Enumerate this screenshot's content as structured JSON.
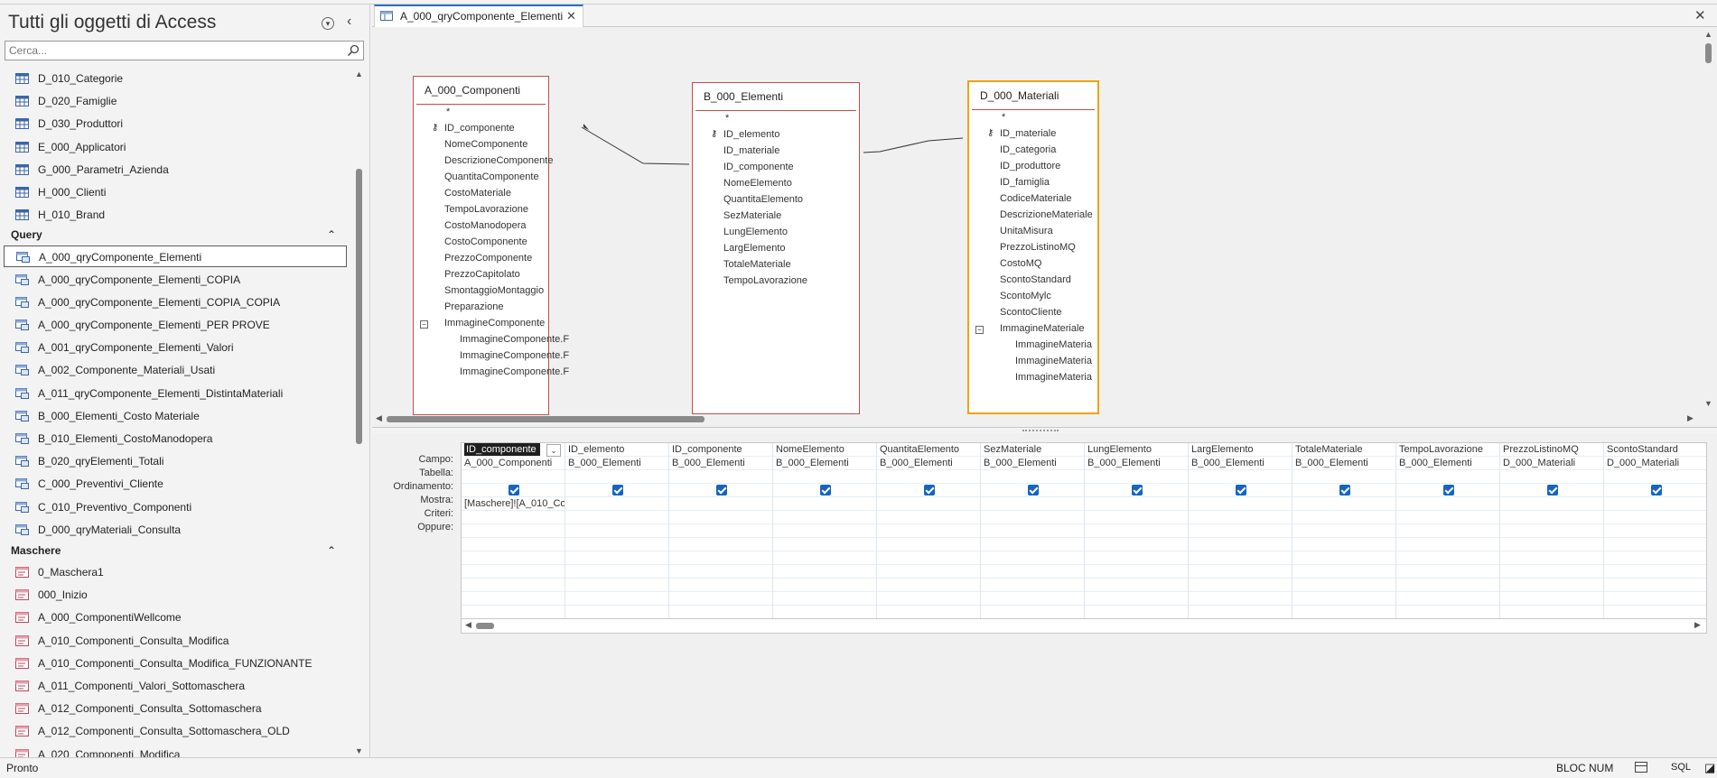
{
  "nav": {
    "title": "Tutti gli oggetti di Access",
    "search_placeholder": "Cerca...",
    "tables": [
      "D_010_Categorie",
      "D_020_Famiglie",
      "D_030_Produttori",
      "E_000_Applicatori",
      "G_000_Parametri_Azienda",
      "H_000_Clienti",
      "H_010_Brand"
    ],
    "query_group": "Query",
    "queries": [
      "A_000_qryComponente_Elementi",
      "A_000_qryComponente_Elementi_COPIA",
      "A_000_qryComponente_Elementi_COPIA_COPIA",
      "A_000_qryComponente_Elementi_PER PROVE",
      "A_001_qryComponente_Elementi_Valori",
      "A_002_Componente_Materiali_Usati",
      "A_011_qryComponente_Elementi_DistintaMateriali",
      "B_000_Elementi_Costo Materiale",
      "B_010_Elementi_CostoManodopera",
      "B_020_qryElementi_Totali",
      "C_000_Preventivi_Cliente",
      "C_010_Preventivo_Componenti",
      "D_000_qryMateriali_Consulta"
    ],
    "forms_group": "Maschere",
    "forms": [
      "0_Maschera1",
      "000_Inizio",
      "A_000_ComponentiWellcome",
      "A_010_Componenti_Consulta_Modifica",
      "A_010_Componenti_Consulta_Modifica_FUNZIONANTE",
      "A_011_Componenti_Valori_Sottomaschera",
      "A_012_Componenti_Consulta_Sottomaschera",
      "A_012_Componenti_Consulta_Sottomaschera_OLD",
      "A_020_Componenti_Modifica"
    ]
  },
  "doc_tab": {
    "label": "A_000_qryComponente_Elementi"
  },
  "tables": [
    {
      "name": "A_000_Componenti",
      "fields": [
        {
          "t": "*",
          "k": "star"
        },
        {
          "t": "ID_componente",
          "k": "key"
        },
        {
          "t": "NomeComponente"
        },
        {
          "t": "DescrizioneComponente"
        },
        {
          "t": "QuantitaComponente"
        },
        {
          "t": "CostoMateriale"
        },
        {
          "t": "TempoLavorazione"
        },
        {
          "t": "CostoManodopera"
        },
        {
          "t": "CostoComponente"
        },
        {
          "t": "PrezzoComponente"
        },
        {
          "t": "PrezzoCapitolato"
        },
        {
          "t": "SmontaggioMontaggio"
        },
        {
          "t": "Preparazione"
        },
        {
          "t": "ImmagineComponente",
          "k": "minus"
        },
        {
          "t": "ImmagineComponente.F",
          "k": "sub"
        },
        {
          "t": "ImmagineComponente.F",
          "k": "sub"
        },
        {
          "t": "ImmagineComponente.F",
          "k": "sub"
        }
      ]
    },
    {
      "name": "B_000_Elementi",
      "fields": [
        {
          "t": "*",
          "k": "star"
        },
        {
          "t": "ID_elemento",
          "k": "key"
        },
        {
          "t": "ID_materiale"
        },
        {
          "t": "ID_componente"
        },
        {
          "t": "NomeElemento"
        },
        {
          "t": "QuantitaElemento"
        },
        {
          "t": "SezMateriale"
        },
        {
          "t": "LungElemento"
        },
        {
          "t": "LargElemento"
        },
        {
          "t": "TotaleMateriale"
        },
        {
          "t": "TempoLavorazione"
        }
      ]
    },
    {
      "name": "D_000_Materiali",
      "fields": [
        {
          "t": "*",
          "k": "star"
        },
        {
          "t": "ID_materiale",
          "k": "key"
        },
        {
          "t": "ID_categoria"
        },
        {
          "t": "ID_produttore"
        },
        {
          "t": "ID_famiglia"
        },
        {
          "t": "CodiceMateriale"
        },
        {
          "t": "DescrizioneMateriale"
        },
        {
          "t": "UnitaMisura"
        },
        {
          "t": "PrezzoListinoMQ"
        },
        {
          "t": "CostoMQ"
        },
        {
          "t": "ScontoStandard"
        },
        {
          "t": "ScontoMylc"
        },
        {
          "t": "ScontoCliente"
        },
        {
          "t": "ImmagineMateriale",
          "k": "minus"
        },
        {
          "t": "ImmagineMateria",
          "k": "sub"
        },
        {
          "t": "ImmagineMateria",
          "k": "sub"
        },
        {
          "t": "ImmagineMateria",
          "k": "sub"
        }
      ]
    }
  ],
  "grid": {
    "row_labels": [
      "Campo:",
      "Tabella:",
      "Ordinamento:",
      "Mostra:",
      "Criteri:",
      "Oppure:"
    ],
    "columns": [
      {
        "field": "ID_componente",
        "table": "A_000_Componenti",
        "show": true,
        "criteria": "[Maschere]![A_010_Co"
      },
      {
        "field": "ID_elemento",
        "table": "B_000_Elementi",
        "show": true,
        "criteria": ""
      },
      {
        "field": "ID_componente",
        "table": "B_000_Elementi",
        "show": true,
        "criteria": ""
      },
      {
        "field": "NomeElemento",
        "table": "B_000_Elementi",
        "show": true,
        "criteria": ""
      },
      {
        "field": "QuantitaElemento",
        "table": "B_000_Elementi",
        "show": true,
        "criteria": ""
      },
      {
        "field": "SezMateriale",
        "table": "B_000_Elementi",
        "show": true,
        "criteria": ""
      },
      {
        "field": "LungElemento",
        "table": "B_000_Elementi",
        "show": true,
        "criteria": ""
      },
      {
        "field": "LargElemento",
        "table": "B_000_Elementi",
        "show": true,
        "criteria": ""
      },
      {
        "field": "TotaleMateriale",
        "table": "B_000_Elementi",
        "show": true,
        "criteria": ""
      },
      {
        "field": "TempoLavorazione",
        "table": "B_000_Elementi",
        "show": true,
        "criteria": ""
      },
      {
        "field": "PrezzoListinoMQ",
        "table": "D_000_Materiali",
        "show": true,
        "criteria": ""
      },
      {
        "field": "ScontoStandard",
        "table": "D_000_Materiali",
        "show": true,
        "criteria": ""
      }
    ]
  },
  "status": {
    "left": "Pronto",
    "numlock": "BLOC NUM",
    "sql": "SQL"
  },
  "colors": {
    "accent": "#2f6fc0",
    "table_border": "#c0504d",
    "active_table": "#f0a30a",
    "checkbox": "#1565c0"
  }
}
